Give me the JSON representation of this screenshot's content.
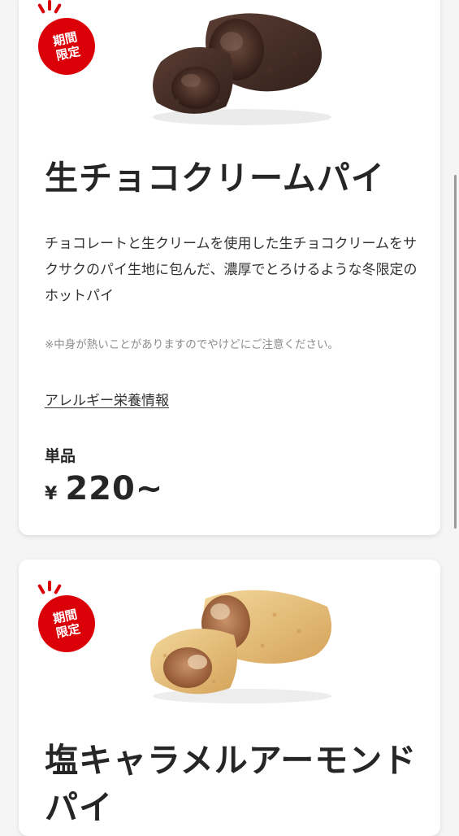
{
  "products": [
    {
      "badge": {
        "line1": "期間",
        "line2": "限定"
      },
      "image_icon": "chocolate-pie-image",
      "title": "生チョコクリームパイ",
      "description": "チョコレートと生クリームを使用した生チョコクリームをサクサクのパイ生地に包んだ、濃厚でとろけるような冬限定のホットパイ",
      "note": "※中身が熱いことがありますのでやけどにご注意ください。",
      "allergen_link": "アレルギー栄養情報",
      "set_label": "単品",
      "price_symbol": "¥",
      "price": "220~"
    },
    {
      "badge": {
        "line1": "期間",
        "line2": "限定"
      },
      "image_icon": "caramel-almond-pie-image",
      "title_line1": "塩キャラメルアーモンド",
      "title_line2": "パイ"
    }
  ],
  "colors": {
    "accent": "#db0007",
    "text": "#262626",
    "background": "#f5f5f5"
  }
}
